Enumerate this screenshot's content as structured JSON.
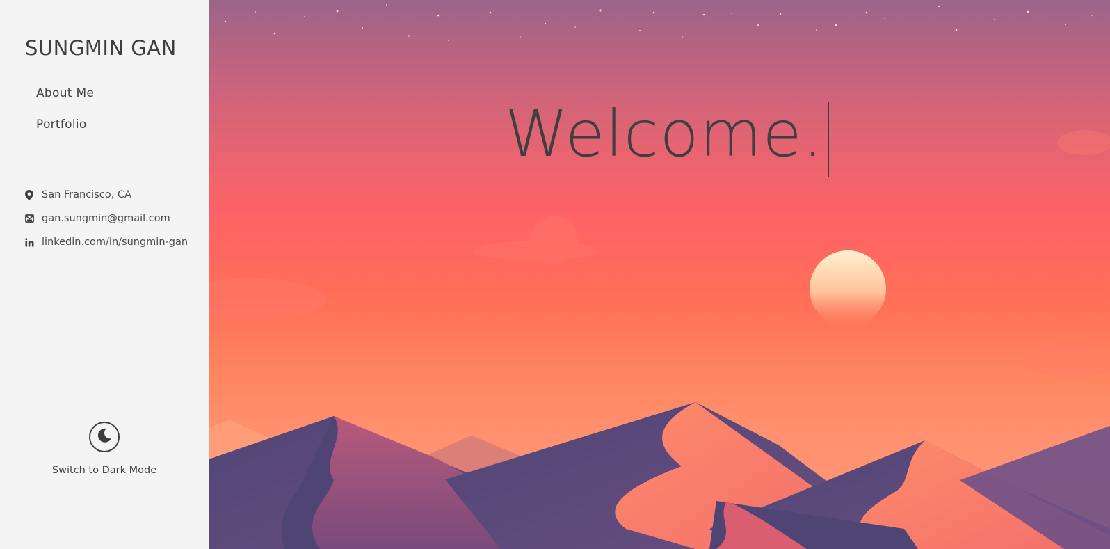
{
  "sidebar": {
    "brand": "SUNGMIN GAN",
    "nav": [
      {
        "label": "About Me"
      },
      {
        "label": "Portfolio"
      }
    ],
    "contact": [
      {
        "icon": "location-pin-icon",
        "text": "San Francisco, CA"
      },
      {
        "icon": "mail-icon",
        "text": "gan.sungmin@gmail.com"
      },
      {
        "icon": "linkedin-icon",
        "text": "linkedin.com/in/sungmin-gan"
      }
    ],
    "dark_mode": {
      "icon": "moon-icon",
      "label": "Switch to Dark Mode"
    }
  },
  "hero": {
    "heading": "Welcome."
  },
  "colors": {
    "sidebar_bg": "#f4f4f4",
    "text": "#3e3e3e",
    "sky_top": "#9b6489",
    "sky_mid": "#ff6366",
    "sky_bottom": "#ff9773",
    "dune_dark": "#4e4575"
  }
}
